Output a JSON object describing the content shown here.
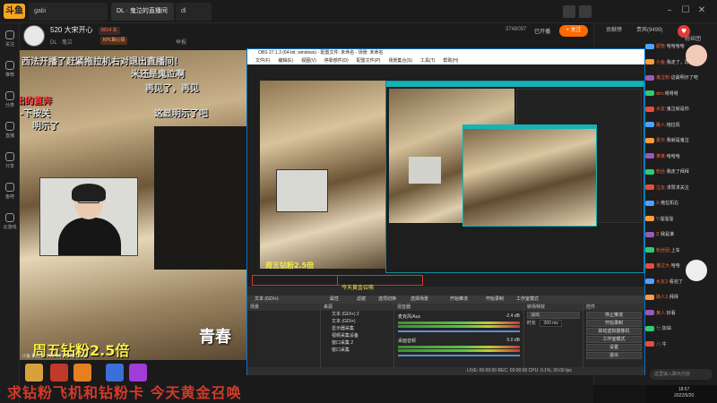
{
  "platform": {
    "logo_text": "斗鱼",
    "search_placeholder": "gabi",
    "tabs": [
      {
        "label": "DL · 鬼泣的直播间"
      },
      {
        "label": "dl"
      }
    ]
  },
  "room": {
    "title": "520 大宋开心",
    "heat": "8014 关",
    "sub_info": "DL · 鬼泣",
    "category": "KPL聊心情",
    "report": "举报",
    "fans_label": "3748097",
    "follow_button": "+ 关注",
    "follow_state": "已开播"
  },
  "left_nav": [
    {
      "label": "关注"
    },
    {
      "label": "推荐"
    },
    {
      "label": "分类"
    },
    {
      "label": "直播"
    },
    {
      "label": "分享"
    },
    {
      "label": "鱼吧"
    },
    {
      "label": "云游戏"
    }
  ],
  "video": {
    "danmu": [
      {
        "text": "西法开播了赶紧拖拉机右对退出直播间！",
        "color": "#ffffff"
      },
      {
        "text": "米还是鬼泣啊",
        "color": "#ffffff"
      },
      {
        "text": "再见了，再见",
        "color": "#ffffff"
      },
      {
        "text": "出的直奔",
        "color": "#ff3b3b"
      },
      {
        "text": "-下按关",
        "color": "#ffffff"
      },
      {
        "text": "明示了",
        "color": "#ffffff"
      },
      {
        "text": "这显明示了吧",
        "color": "#ffffff"
      }
    ],
    "banner": "周五钻粉2.5倍",
    "overlay_title": "青春",
    "stats": "斗鱼 播放中 793400 | 2022.05.20"
  },
  "bottom": {
    "slogan": "求钻粉飞机和钻粉卡 今天黄金召唤"
  },
  "obs": {
    "title": "OBS 27.1.3 (64-bit, windows) - 配置文件: 未命名 - 场景: 未命名",
    "menu": [
      "文件(F)",
      "编辑(E)",
      "视图(V)",
      "停靠部件(D)",
      "配置文件(P)",
      "场景集合(S)",
      "工具(T)",
      "帮助(H)"
    ],
    "scene_tabs": [
      "文本 (GDI+)",
      "属性",
      "滤镜",
      "选项切换",
      "选择场景",
      "开始推流",
      "开始录制",
      "工作室模式"
    ],
    "scenes_header": "场景",
    "sources_header": "来源",
    "mixer_header": "混音器",
    "transitions_header": "转场特效",
    "controls_header": "控件",
    "sources": [
      "文本 (GDI+) 2",
      "文本 (GDI+)",
      "显示器采集",
      "视频采集设备",
      "窗口采集 2",
      "窗口采集"
    ],
    "mixer": [
      {
        "name": "麦克风/Aux",
        "db": "-2.4 dB"
      },
      {
        "name": "桌面音频",
        "db": "0.0 dB"
      }
    ],
    "transition": {
      "name": "淡出",
      "duration_label": "时长",
      "duration": "300 ms"
    },
    "controls": [
      "停止推流",
      "开始录制",
      "启动虚拟摄像机",
      "工作室模式",
      "设置",
      "退出"
    ],
    "status": "LIVE: 00:00:00   REC: 00:00:00   CPU: 0.1%, 30.00 fps",
    "yellow_text": "周五钻粉2.5倍",
    "red_box_text": "今天黄金召唤"
  },
  "right_panel": {
    "tabs": [
      "贡献榜",
      "贵宾(9499)",
      "粉丝团"
    ],
    "chat": [
      {
        "name": "超管:",
        "msg": "哈哈哈哈"
      },
      {
        "name": "小鱼:",
        "msg": "我走了，再见"
      },
      {
        "name": "鬼泣粉:",
        "msg": "这最明示了吧"
      },
      {
        "name": "dm:",
        "msg": "呀呀呀"
      },
      {
        "name": "水友:",
        "msg": "鬼泣就是你"
      },
      {
        "name": "路人:",
        "msg": "拖拉机"
      },
      {
        "name": "夏天:",
        "msg": "我就是鬼泣"
      },
      {
        "name": "某某:",
        "msg": "哈哈哈"
      },
      {
        "name": "粉丝:",
        "msg": "我走了拜拜"
      },
      {
        "name": "泣友:",
        "msg": "求赞求关注"
      },
      {
        "name": "X:",
        "msg": "拖拉机右"
      },
      {
        "name": "Y:",
        "msg": "溜溜溜"
      },
      {
        "name": "Z:",
        "msg": "我是谁"
      },
      {
        "name": "粉丝团:",
        "msg": "上车"
      },
      {
        "name": "鬼泣大:",
        "msg": "哈哈"
      },
      {
        "name": "水友2:",
        "msg": "看完了"
      },
      {
        "name": "路人2:",
        "msg": "拜拜"
      },
      {
        "name": "某人:",
        "msg": "好看"
      },
      {
        "name": "七:",
        "msg": "加油"
      },
      {
        "name": "八:",
        "msg": "牛"
      }
    ],
    "chat_input_placeholder": "这里输入聊天内容"
  },
  "tray": {
    "time": "18:57",
    "date": "2022/5/20"
  },
  "colors": {
    "brand": "#f5a623",
    "follow": "#ff6a00",
    "accent_red": "#d43a2a",
    "obs_teal": "#16b2b7",
    "banner_yellow": "#f8f04a"
  }
}
